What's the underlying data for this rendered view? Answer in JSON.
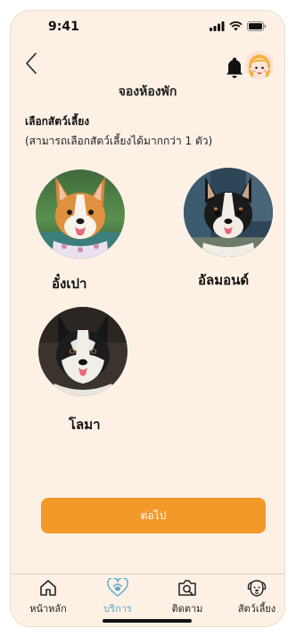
{
  "status_bar": {
    "time": "9:41"
  },
  "header": {
    "title": "จองห้องพัก",
    "back_icon": "chevron-left-icon",
    "bell_icon": "bell-icon"
  },
  "section": {
    "title": "เลือกสัตว์เลี้ยง",
    "subtitle": "(สามารถเลือกสัตว์เลี้ยงได้มากกว่า 1 ตัว)"
  },
  "pets": [
    {
      "name": "อั๋งเปา",
      "breed_icon": "corgi-photo"
    },
    {
      "name": "อัลมอนด์",
      "breed_icon": "black-corgi-photo"
    },
    {
      "name": "โลมา",
      "breed_icon": "husky-photo"
    }
  ],
  "continue_label": "ต่อไป",
  "tabs": [
    {
      "label": "หน้าหลัก",
      "icon": "home-icon",
      "active": false
    },
    {
      "label": "บริการ",
      "icon": "paw-heart-icon",
      "active": true
    },
    {
      "label": "ติดตาม",
      "icon": "camera-search-icon",
      "active": false
    },
    {
      "label": "สัตว์เลี้ยง",
      "icon": "dog-face-icon",
      "active": false
    }
  ],
  "colors": {
    "background": "#FDF1E6",
    "accent": "#F29A29",
    "active_tab": "#5BA7C9"
  }
}
